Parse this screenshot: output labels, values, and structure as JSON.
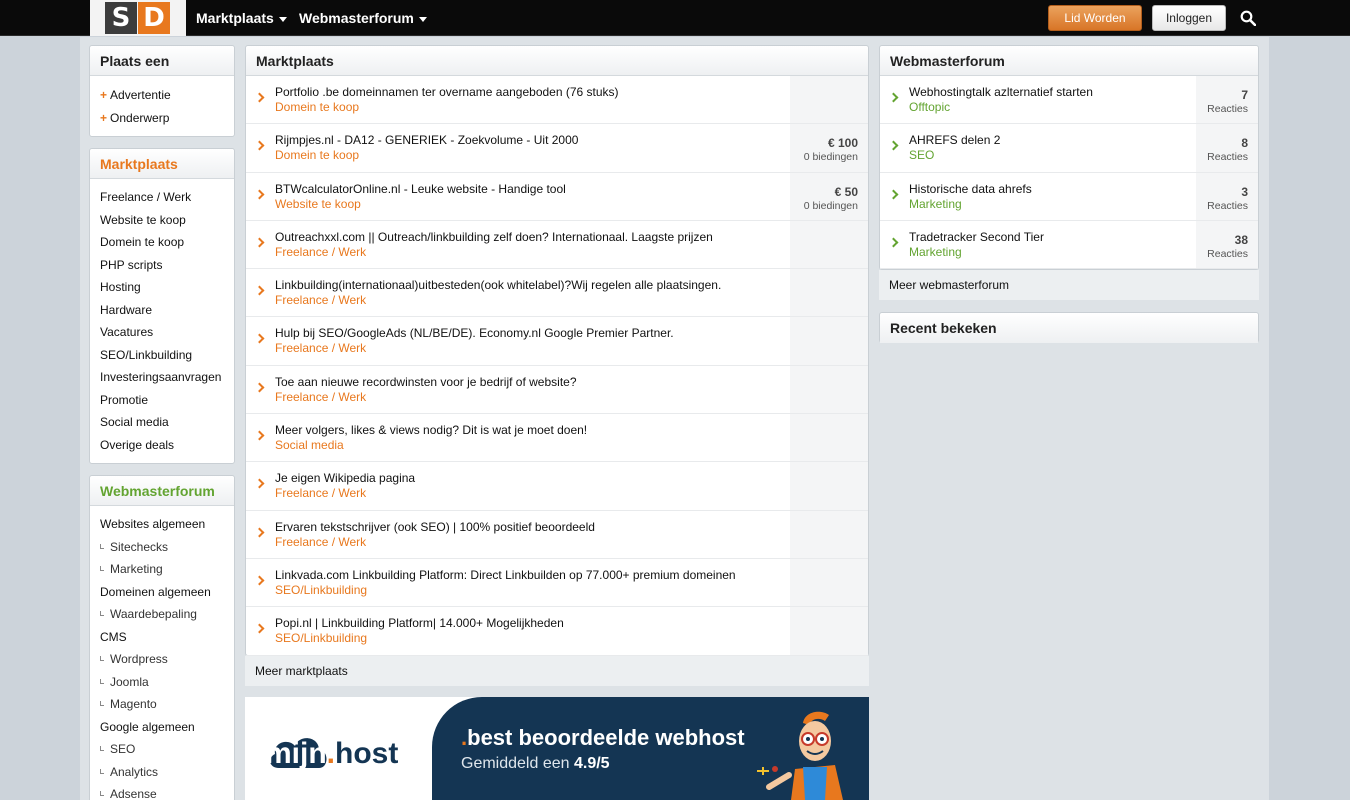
{
  "logo": {
    "s": "S",
    "d": "D"
  },
  "header": {
    "nav": [
      "Marktplaats",
      "Webmasterforum"
    ],
    "register": "Lid Worden",
    "login": "Inloggen"
  },
  "plaats": {
    "title": "Plaats een",
    "items": [
      "Advertentie",
      "Onderwerp"
    ]
  },
  "marktplaats_menu": {
    "title": "Marktplaats",
    "items": [
      "Freelance / Werk",
      "Website te koop",
      "Domein te koop",
      "PHP scripts",
      "Hosting",
      "Hardware",
      "Vacatures",
      "SEO/Linkbuilding",
      "Investeringsaanvragen",
      "Promotie",
      "Social media",
      "Overige deals"
    ]
  },
  "forum_menu": {
    "title": "Webmasterforum",
    "items": [
      {
        "label": "Websites algemeen",
        "sub": false
      },
      {
        "label": "Sitechecks",
        "sub": true
      },
      {
        "label": "Marketing",
        "sub": true
      },
      {
        "label": "Domeinen algemeen",
        "sub": false
      },
      {
        "label": "Waardebepaling",
        "sub": true
      },
      {
        "label": "CMS",
        "sub": false
      },
      {
        "label": "Wordpress",
        "sub": true
      },
      {
        "label": "Joomla",
        "sub": true
      },
      {
        "label": "Magento",
        "sub": true
      },
      {
        "label": "Google algemeen",
        "sub": false
      },
      {
        "label": "SEO",
        "sub": true
      },
      {
        "label": "Analytics",
        "sub": true
      },
      {
        "label": "Adsense",
        "sub": true
      }
    ]
  },
  "marktplaats": {
    "title": "Marktplaats",
    "rows": [
      {
        "title": "Portfolio .be domeinnamen ter overname aangeboden (76 stuks)",
        "category": "Domein te koop",
        "price": "",
        "bids": ""
      },
      {
        "title": "Rijmpjes.nl - DA12 - GENERIEK - Zoekvolume - Uit 2000",
        "category": "Domein te koop",
        "price": "€ 100",
        "bids": "0 biedingen"
      },
      {
        "title": "BTWcalculatorOnline.nl - Leuke website - Handige tool",
        "category": "Website te koop",
        "price": "€ 50",
        "bids": "0 biedingen"
      },
      {
        "title": "Outreachxxl.com || Outreach/linkbuilding zelf doen? Internationaal. Laagste prijzen",
        "category": "Freelance / Werk",
        "price": "",
        "bids": ""
      },
      {
        "title": "Linkbuilding(internationaal)uitbesteden(ook whitelabel)?Wij regelen alle plaatsingen.",
        "category": "Freelance / Werk",
        "price": "",
        "bids": ""
      },
      {
        "title": "Hulp bij SEO/GoogleAds (NL/BE/DE). Economy.nl Google Premier Partner.",
        "category": "Freelance / Werk",
        "price": "",
        "bids": ""
      },
      {
        "title": "Toe aan nieuwe recordwinsten voor je bedrijf of website?",
        "category": "Freelance / Werk",
        "price": "",
        "bids": ""
      },
      {
        "title": "Meer volgers, likes & views nodig? Dit is wat je moet doen!",
        "category": "Social media",
        "price": "",
        "bids": ""
      },
      {
        "title": "Je eigen Wikipedia pagina",
        "category": "Freelance / Werk",
        "price": "",
        "bids": ""
      },
      {
        "title": "Ervaren tekstschrijver (ook SEO) | 100% positief beoordeeld",
        "category": "Freelance / Werk",
        "price": "",
        "bids": ""
      },
      {
        "title": "Linkvada.com Linkbuilding Platform: Direct Linkbuilden op 77.000+ premium domeinen",
        "category": "SEO/Linkbuilding",
        "price": "",
        "bids": ""
      },
      {
        "title": "Popi.nl | Linkbuilding Platform| 14.000+ Mogelijkheden",
        "category": "SEO/Linkbuilding",
        "price": "",
        "bids": ""
      }
    ],
    "more": "Meer marktplaats"
  },
  "webmasterforum": {
    "title": "Webmasterforum",
    "rows": [
      {
        "title": "Webhostingtalk azlternatief starten",
        "category": "Offtopic",
        "count": "7",
        "label": "Reacties"
      },
      {
        "title": "AHREFS delen 2",
        "category": "SEO",
        "count": "8",
        "label": "Reacties"
      },
      {
        "title": "Historische data ahrefs",
        "category": "Marketing",
        "count": "3",
        "label": "Reacties"
      },
      {
        "title": "Tradetracker Second Tier",
        "category": "Marketing",
        "count": "38",
        "label": "Reacties"
      }
    ],
    "more": "Meer webmasterforum"
  },
  "recent": {
    "title": "Recent bekeken"
  },
  "banner": {
    "brand_a": "mijn",
    "brand_dot": ".",
    "brand_b": "host",
    "headline_dot": ".",
    "headline": "best beoordeelde webhost",
    "sub_a": "Gemiddeld een ",
    "sub_b": "4.9/5"
  },
  "colors": {
    "accent": "#e8781e",
    "forum_green": "#63a431",
    "banner_navy": "#143553"
  }
}
